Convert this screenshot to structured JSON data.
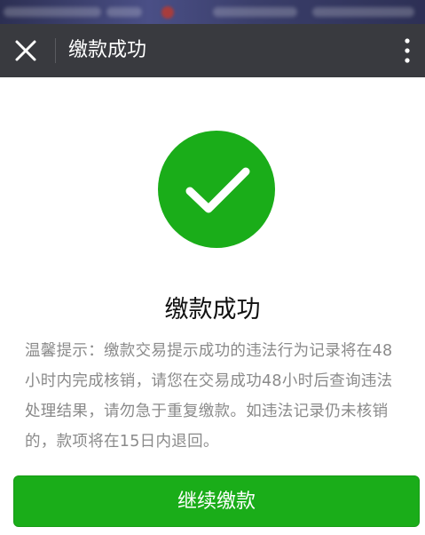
{
  "header": {
    "title": "缴款成功",
    "close_icon": "close-icon",
    "more_icon": "more-vertical-icon"
  },
  "result": {
    "icon": "checkmark-circle-icon",
    "title": "缴款成功",
    "tip": "温馨提示：缴款交易提示成功的违法行为记录将在48小时内完成核销，请您在交易成功48小时后查询违法处理结果，请勿急于重复缴款。如违法记录仍未核销的，款项将在15日内退回。"
  },
  "actions": {
    "continue_label": "继续缴款"
  },
  "colors": {
    "nav_background": "#393a3f",
    "accent_green": "#1aad19"
  }
}
